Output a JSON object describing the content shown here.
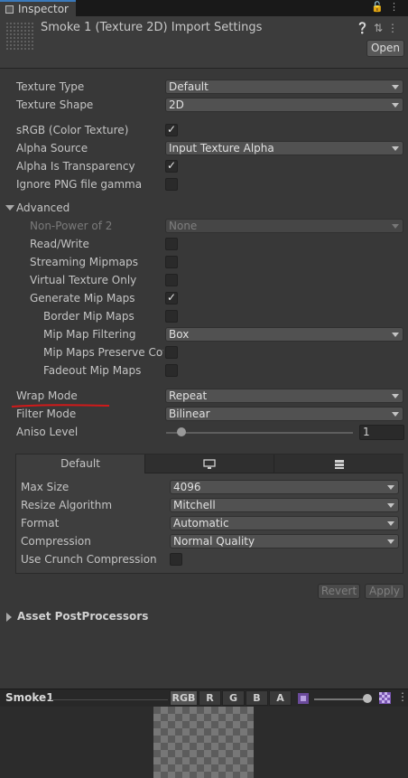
{
  "tab": {
    "label": "Inspector"
  },
  "header": {
    "title": "Smoke 1 (Texture 2D) Import Settings",
    "open_label": "Open"
  },
  "fields": {
    "texture_type": {
      "label": "Texture Type",
      "value": "Default"
    },
    "texture_shape": {
      "label": "Texture Shape",
      "value": "2D"
    },
    "srgb": {
      "label": "sRGB (Color Texture)",
      "checked": true
    },
    "alpha_source": {
      "label": "Alpha Source",
      "value": "Input Texture Alpha"
    },
    "alpha_transparency": {
      "label": "Alpha Is Transparency",
      "checked": true
    },
    "ignore_png_gamma": {
      "label": "Ignore PNG file gamma",
      "checked": false
    }
  },
  "advanced": {
    "label": "Advanced",
    "non_power_of_2": {
      "label": "Non-Power of 2",
      "value": "None"
    },
    "read_write": {
      "label": "Read/Write",
      "checked": false
    },
    "streaming_mipmaps": {
      "label": "Streaming Mipmaps",
      "checked": false
    },
    "virtual_texture_only": {
      "label": "Virtual Texture Only",
      "checked": false
    },
    "generate_mip_maps": {
      "label": "Generate Mip Maps",
      "checked": true
    },
    "border_mip_maps": {
      "label": "Border Mip Maps",
      "checked": false
    },
    "mip_map_filtering": {
      "label": "Mip Map Filtering",
      "value": "Box"
    },
    "mip_maps_preserve_coverage": {
      "label": "Mip Maps Preserve Cov",
      "checked": false
    },
    "fadeout_mip_maps": {
      "label": "Fadeout Mip Maps",
      "checked": false
    }
  },
  "wrap_mode": {
    "label": "Wrap Mode",
    "value": "Repeat"
  },
  "filter_mode": {
    "label": "Filter Mode",
    "value": "Bilinear"
  },
  "aniso_level": {
    "label": "Aniso Level",
    "value": "1",
    "slider_fraction": 0.0
  },
  "platform": {
    "tabs": [
      {
        "label": "Default",
        "icon": ""
      },
      {
        "label": "",
        "icon": "monitor-icon"
      },
      {
        "label": "",
        "icon": "server-icon"
      }
    ],
    "max_size": {
      "label": "Max Size",
      "value": "4096"
    },
    "resize_algorithm": {
      "label": "Resize Algorithm",
      "value": "Mitchell"
    },
    "format": {
      "label": "Format",
      "value": "Automatic"
    },
    "compression": {
      "label": "Compression",
      "value": "Normal Quality"
    },
    "use_crunch": {
      "label": "Use Crunch Compression",
      "checked": false
    }
  },
  "actions": {
    "revert_label": "Revert",
    "apply_label": "Apply"
  },
  "asset_postprocessors": {
    "label": "Asset PostProcessors"
  },
  "preview": {
    "name": "Smoke1",
    "channels": [
      "RGB",
      "R",
      "G",
      "B",
      "A"
    ],
    "selected_channel": "RGB"
  },
  "colors": {
    "annotation_underline": "#d01a1a",
    "tab_accent": "#3a79bb"
  }
}
